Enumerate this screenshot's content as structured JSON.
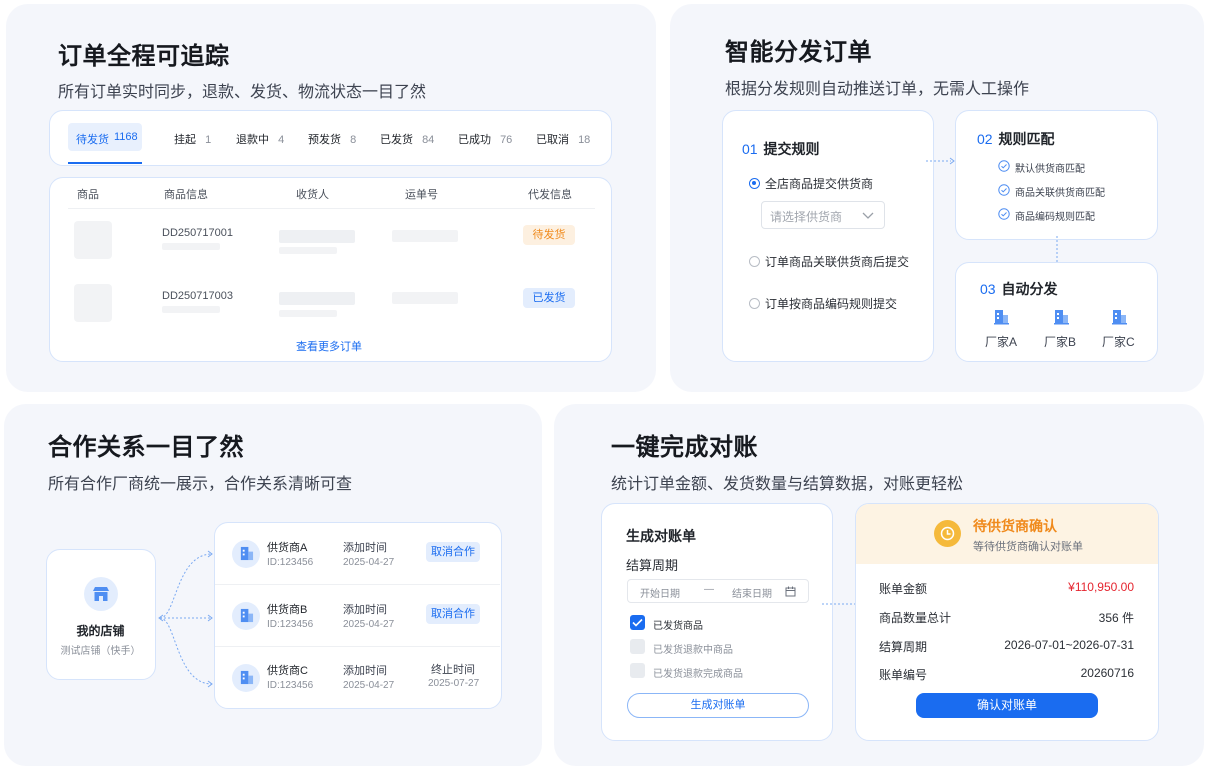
{
  "p1": {
    "title": "订单全程可追踪",
    "subtitle": "所有订单实时同步，退款、发货、物流状态一目了然",
    "tabs": [
      {
        "label": "待发货",
        "count": "1168"
      },
      {
        "label": "挂起",
        "count": "1"
      },
      {
        "label": "退款中",
        "count": "4"
      },
      {
        "label": "预发货",
        "count": "8"
      },
      {
        "label": "已发货",
        "count": "84"
      },
      {
        "label": "已成功",
        "count": "76"
      },
      {
        "label": "已取消",
        "count": "18"
      }
    ],
    "columns": [
      "商品",
      "商品信息",
      "收货人",
      "运单号",
      "代发信息"
    ],
    "rows": [
      {
        "order": "DD250717001",
        "status": "待发货"
      },
      {
        "order": "DD250717003",
        "status": "已发货"
      }
    ],
    "more": "查看更多订单"
  },
  "p2": {
    "title": "智能分发订单",
    "subtitle": "根据分发规则自动推送订单，无需人工操作",
    "step1": {
      "num": "01",
      "title": "提交规则",
      "opt1": "全店商品提交供货商",
      "select_placeholder": "请选择供货商",
      "opt2": "订单商品关联供货商后提交",
      "opt3": "订单按商品编码规则提交"
    },
    "step2": {
      "num": "02",
      "title": "规则匹配",
      "items": [
        "默认供货商匹配",
        "商品关联供货商匹配",
        "商品编码规则匹配"
      ]
    },
    "step3": {
      "num": "03",
      "title": "自动分发",
      "factories": [
        "厂家A",
        "厂家B",
        "厂家C"
      ]
    }
  },
  "p3": {
    "title": "合作关系一目了然",
    "subtitle": "所有合作厂商统一展示，合作关系清晰可查",
    "store": {
      "name": "我的店铺",
      "desc": "测试店铺（快手）"
    },
    "suppliers": [
      {
        "name": "供货商A",
        "id": "ID:123456",
        "time_label": "添加时间",
        "time": "2025-04-27",
        "action": "取消合作"
      },
      {
        "name": "供货商B",
        "id": "ID:123456",
        "time_label": "添加时间",
        "time": "2025-04-27",
        "action": "取消合作"
      },
      {
        "name": "供货商C",
        "id": "ID:123456",
        "time_label": "添加时间",
        "time": "2025-04-27",
        "end_label": "终止时间",
        "end_time": "2025-07-27"
      }
    ]
  },
  "p4": {
    "title": "一键完成对账",
    "subtitle": "统计订单金额、发货数量与结算数据，对账更轻松",
    "form": {
      "title": "生成对账单",
      "period_label": "结算周期",
      "start_placeholder": "开始日期",
      "sep": "—",
      "end_placeholder": "结束日期",
      "checks": [
        "已发货商品",
        "已发货退款中商品",
        "已发货退款完成商品"
      ],
      "button": "生成对账单"
    },
    "confirm": {
      "title": "待供货商确认",
      "desc": "等待供货商确认对账单",
      "rows": [
        {
          "label": "账单金额",
          "value": "¥110,950.00"
        },
        {
          "label": "商品数量总计",
          "value": "356 件"
        },
        {
          "label": "结算周期",
          "value": "2026-07-01~2026-07-31"
        },
        {
          "label": "账单编号",
          "value": "20260716"
        }
      ],
      "button": "确认对账单"
    }
  },
  "colors": {
    "accent": "#1a6cf0",
    "orange": "#f08a1c",
    "red": "#e5252f",
    "panel": "#f4f6fb"
  }
}
